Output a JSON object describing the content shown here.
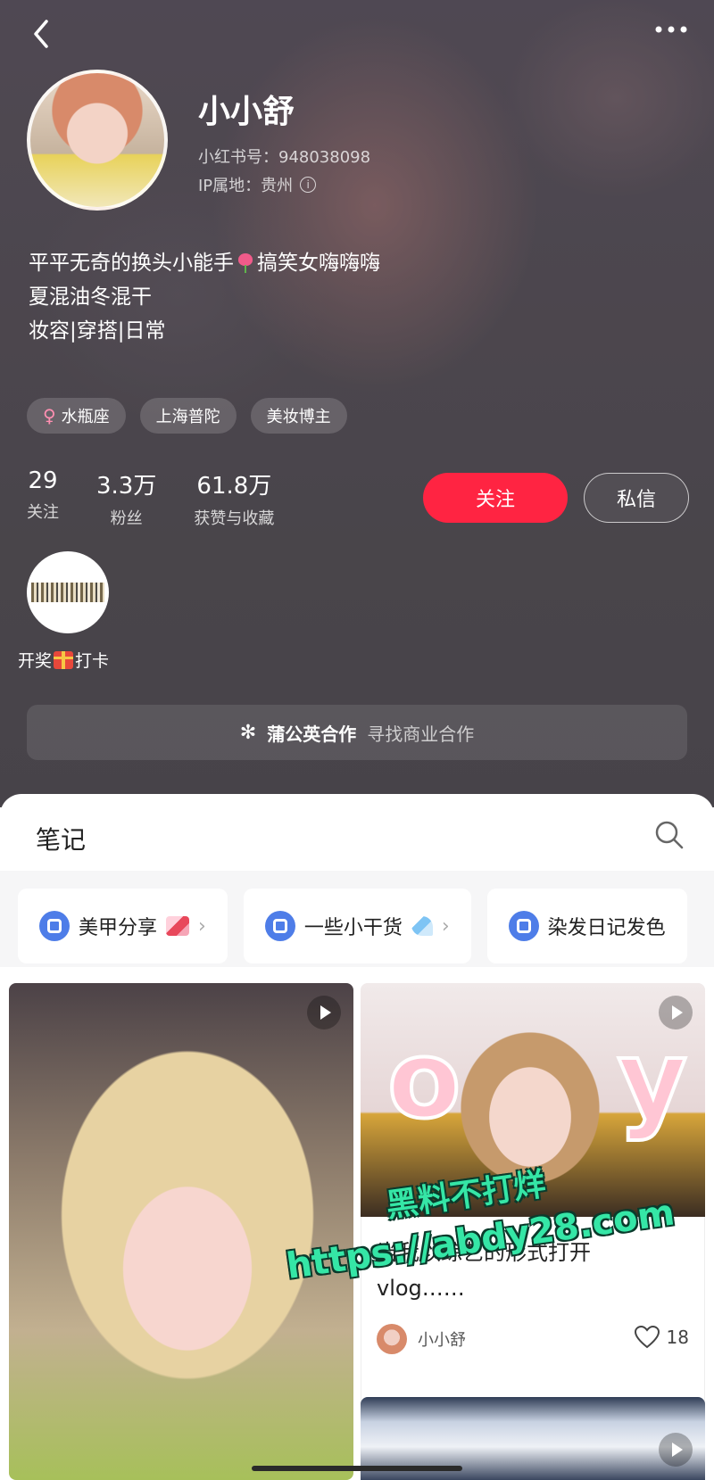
{
  "profile": {
    "name": "小小舒",
    "id_line": "小红书号：948038098",
    "ip_line": "IP属地：贵州",
    "bio": {
      "line1_a": "平平无奇的换头小能手",
      "line1_b": "搞笑女嗨嗨嗨",
      "line2": "夏混油冬混干",
      "line3": "妆容|穿搭|日常"
    },
    "tags": [
      "水瓶座",
      "上海普陀",
      "美妆博主"
    ],
    "stats": [
      {
        "value": "29",
        "label": "关注"
      },
      {
        "value": "3.3万",
        "label": "粉丝"
      },
      {
        "value": "61.8万",
        "label": "获赞与收藏"
      }
    ],
    "follow_label": "关注",
    "message_label": "私信",
    "highlight_label": "开奖",
    "highlight_label_b": "打卡",
    "coop_title": "蒲公英合作",
    "coop_sub": "寻找商业合作"
  },
  "notes": {
    "title": "笔记",
    "collections": [
      {
        "label": "美甲分享"
      },
      {
        "label": "一些小干货"
      },
      {
        "label": "染发日记发色"
      }
    ],
    "card2": {
      "cover_text_left": "o",
      "cover_text_right": "y",
      "title_line1": "当我以综艺的形式打开",
      "title_line2": "vlog……",
      "author": "小小舒",
      "likes": "18"
    }
  },
  "watermark": {
    "line1": "黑料不打烊",
    "line2": "https://abdy28.com"
  },
  "icons": {
    "back": "chevron-left-icon",
    "more": "more-dots-icon",
    "search": "search-icon",
    "heart": "heart-icon",
    "play": "play-icon",
    "info": "info-icon"
  },
  "colors": {
    "accent": "#ff2442",
    "collection_icon": "#4e7de8",
    "watermark": "#35e6a6"
  }
}
